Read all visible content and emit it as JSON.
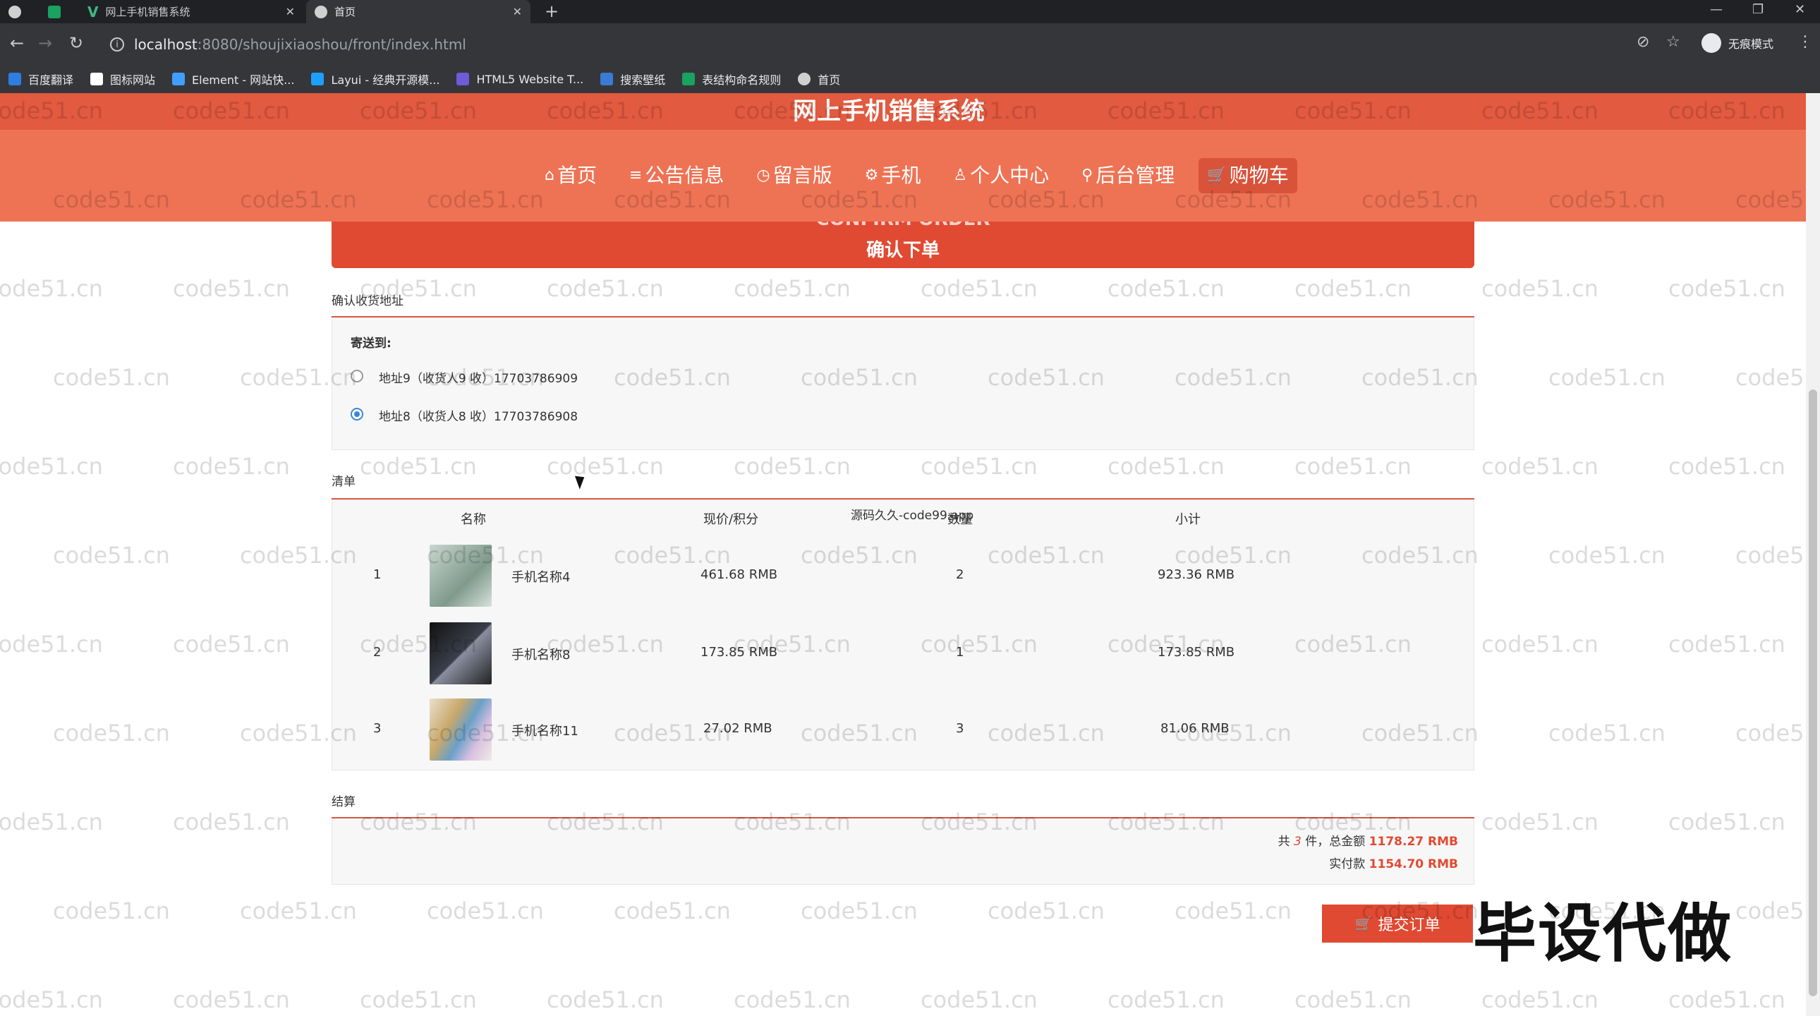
{
  "browser": {
    "tabs": [
      {
        "title": "",
        "icon": "globe-icon"
      },
      {
        "title": "",
        "icon": "green-app-icon"
      },
      {
        "title": "网上手机销售系统",
        "icon": "vue-icon"
      },
      {
        "title": "首页",
        "icon": "globe-icon"
      }
    ],
    "new_tab": "+",
    "address": {
      "host": "localhost",
      "path": ":8080/shoujixiaoshou/front/index.html"
    },
    "incognito_label": "无痕模式",
    "bookmarks": [
      {
        "label": "百度翻译",
        "color": "#2f7de1"
      },
      {
        "label": "图标网站",
        "color": "#ffffff"
      },
      {
        "label": "Element - 网站快...",
        "color": "#409eff"
      },
      {
        "label": "Layui - 经典开源模...",
        "color": "#1e9fff"
      },
      {
        "label": "HTML5 Website T...",
        "color": "#6f5ad7"
      },
      {
        "label": "搜索壁纸",
        "color": "#3a7bd5"
      },
      {
        "label": "表结构命名规则",
        "color": "#1aa260"
      },
      {
        "label": "首页",
        "color": "#d0d0d0"
      }
    ]
  },
  "site": {
    "title": "网上手机销售系统",
    "menu": [
      {
        "icon": "⌂",
        "label": "首页"
      },
      {
        "icon": "≡",
        "label": "公告信息"
      },
      {
        "icon": "◷",
        "label": "留言版"
      },
      {
        "icon": "⚙",
        "label": "手机"
      },
      {
        "icon": "♙",
        "label": "个人中心"
      },
      {
        "icon": "⚲",
        "label": "后台管理"
      },
      {
        "icon": "🛒",
        "label": "购物车"
      }
    ]
  },
  "order": {
    "banner_en": "CONFIRM ORDER",
    "banner_zh": "确认下单",
    "address_section": "确认收货地址",
    "ship_to": "寄送到:",
    "addresses": [
      {
        "text": "地址9（收货人9 收）17703786909",
        "checked": false
      },
      {
        "text": "地址8（收货人8 收）17703786908",
        "checked": true
      }
    ],
    "list_section": "清单",
    "columns": {
      "name": "名称",
      "price": "现价/积分",
      "qty": "数量",
      "subtotal": "小计"
    },
    "floating_note": "源码久久-code99.app",
    "items": [
      {
        "index": "1",
        "name": "手机名称4",
        "price": "461.68 RMB",
        "qty": "2",
        "subtotal": "923.36 RMB",
        "thumb_color": "#9fb3a8"
      },
      {
        "index": "2",
        "name": "手机名称8",
        "price": "173.85 RMB",
        "qty": "1",
        "subtotal": "173.85 RMB",
        "thumb_color": "#2a2d33"
      },
      {
        "index": "3",
        "name": "手机名称11",
        "price": "27.02 RMB",
        "qty": "3",
        "subtotal": "81.06 RMB",
        "thumb_color": "#b9a27a"
      }
    ],
    "settle_section": "结算",
    "summary": {
      "prefix": "共",
      "count": "3",
      "mid": "件，总金额",
      "total": "1178.27 RMB",
      "paid_label": "实付款",
      "paid": "1154.70 RMB"
    },
    "submit_label": "提交订单"
  },
  "overlay_text": "毕设代做",
  "watermark": "code51.cn",
  "accent_color": "#e04a32"
}
